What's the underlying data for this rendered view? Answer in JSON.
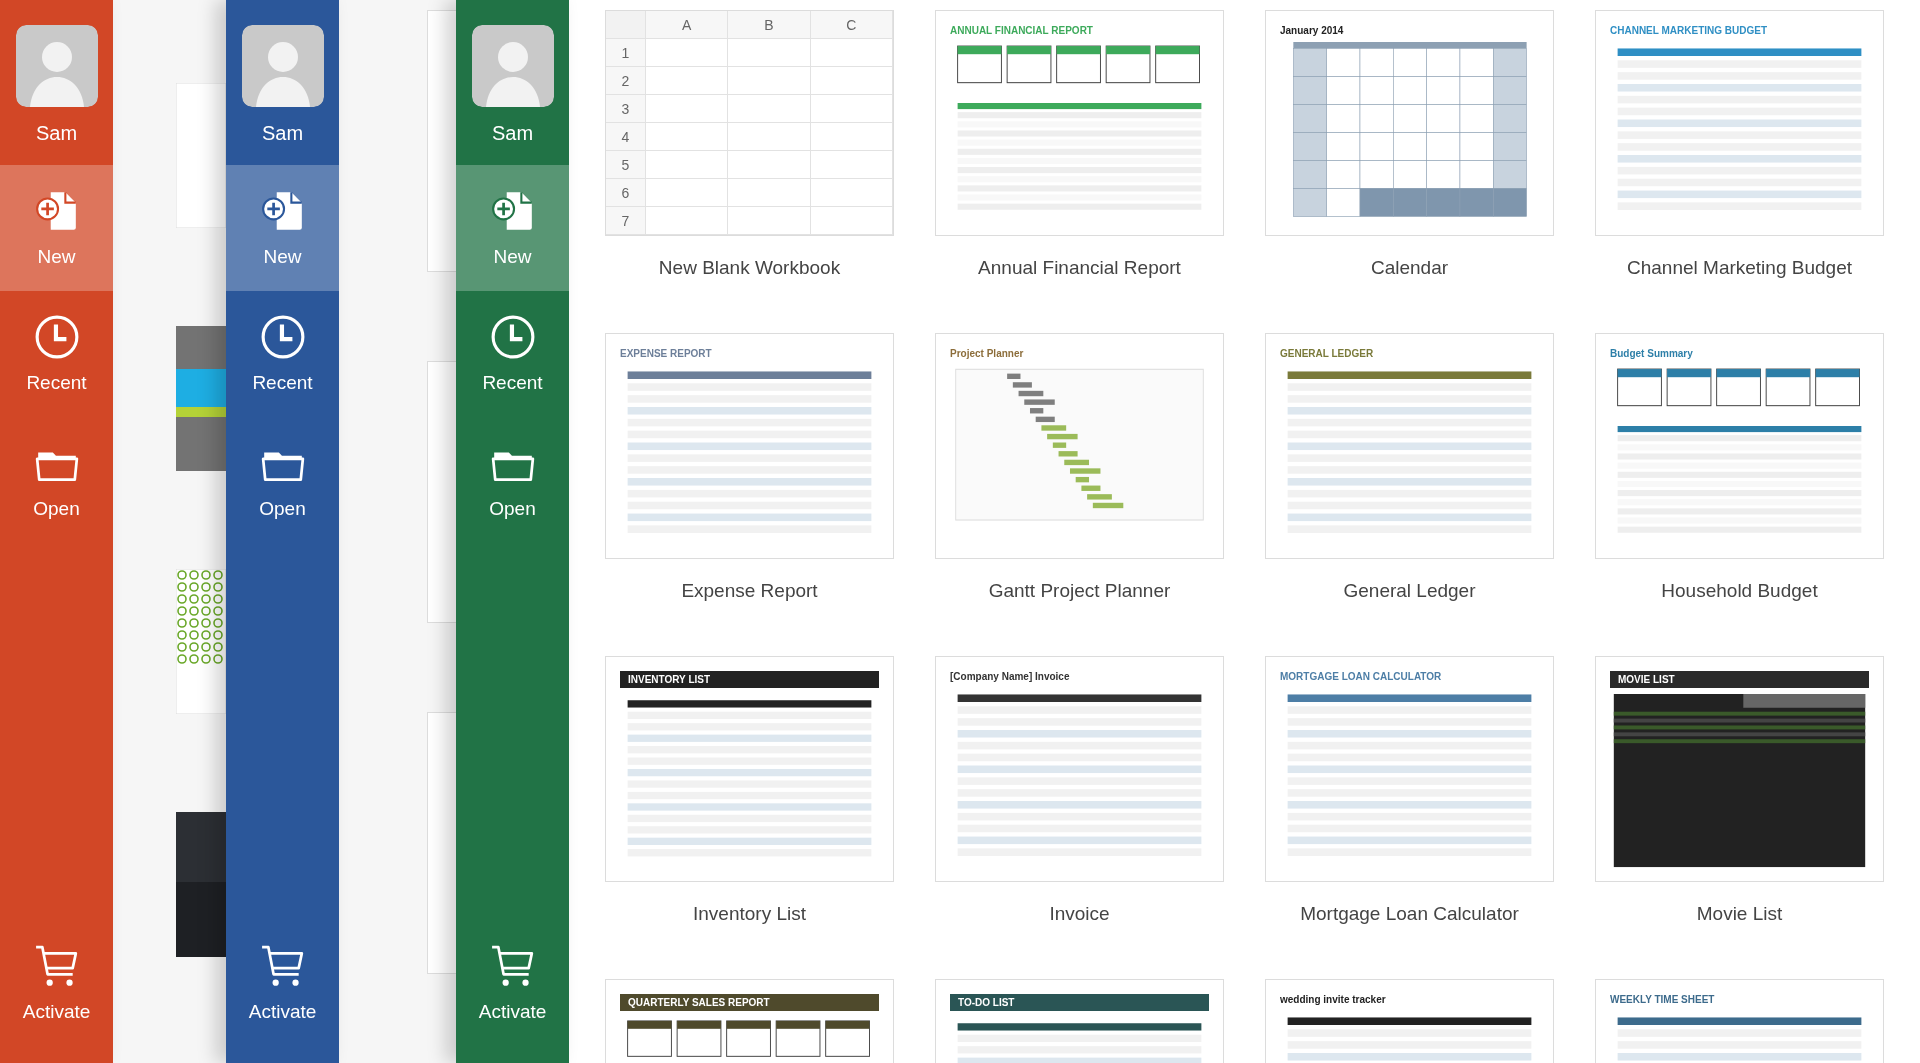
{
  "sidebars": [
    {
      "color": "#d24726",
      "user": "Sam",
      "items": [
        {
          "kind": "new",
          "label": "New",
          "selected": true
        },
        {
          "kind": "recent",
          "label": "Recent",
          "selected": false
        },
        {
          "kind": "open",
          "label": "Open",
          "selected": false
        }
      ],
      "footer": {
        "kind": "cart",
        "label": "Activate"
      }
    },
    {
      "color": "#2b579a",
      "user": "Sam",
      "items": [
        {
          "kind": "new",
          "label": "New",
          "selected": true
        },
        {
          "kind": "recent",
          "label": "Recent",
          "selected": false
        },
        {
          "kind": "open",
          "label": "Open",
          "selected": false
        }
      ],
      "footer": {
        "kind": "cart",
        "label": "Activate"
      }
    },
    {
      "color": "#217346",
      "user": "Sam",
      "items": [
        {
          "kind": "new",
          "label": "New",
          "selected": true
        },
        {
          "kind": "recent",
          "label": "Recent",
          "selected": false
        },
        {
          "kind": "open",
          "label": "Open",
          "selected": false
        }
      ],
      "footer": {
        "kind": "cart",
        "label": "Activate"
      }
    }
  ],
  "slides_behind": [
    {
      "kind": "blank"
    },
    {
      "kind": "stripes"
    },
    {
      "kind": "pattern"
    },
    {
      "kind": "dark"
    }
  ],
  "documents_behind": [
    {
      "kind": "page"
    },
    {
      "kind": "page"
    },
    {
      "kind": "page"
    }
  ],
  "templates": [
    {
      "kind": "blank",
      "name": "New Blank Workbook",
      "columns": [
        "A",
        "B",
        "C"
      ],
      "rows": [
        "1",
        "2",
        "3",
        "4",
        "5",
        "6",
        "7"
      ]
    },
    {
      "kind": "report",
      "name": "Annual Financial Report",
      "heading": "ANNUAL FINANCIAL REPORT",
      "heading_bar": false,
      "color": "#3daa5b"
    },
    {
      "kind": "calendar",
      "name": "Calendar",
      "heading": "January 2014",
      "heading_bar": false,
      "color": "#222222"
    },
    {
      "kind": "table",
      "name": "Channel Marketing Budget",
      "heading": "CHANNEL MARKETING BUDGET",
      "heading_bar": false,
      "color": "#2f8fc4"
    },
    {
      "kind": "table",
      "name": "Expense Report",
      "heading": "EXPENSE REPORT",
      "heading_bar": false,
      "color": "#6d7f99"
    },
    {
      "kind": "gantt",
      "name": "Gantt Project Planner",
      "heading": "Project Planner",
      "heading_bar": false,
      "color": "#8c6d3a"
    },
    {
      "kind": "table",
      "name": "General Ledger",
      "heading": "GENERAL LEDGER",
      "heading_bar": false,
      "color": "#7a7a3a"
    },
    {
      "kind": "report",
      "name": "Household Budget",
      "heading": "Budget Summary",
      "heading_bar": false,
      "color": "#2d7fa8"
    },
    {
      "kind": "table",
      "name": "Inventory List",
      "heading": "INVENTORY LIST",
      "heading_bar": true,
      "color": "#222222"
    },
    {
      "kind": "table",
      "name": "Invoice",
      "heading": "[Company Name] Invoice",
      "heading_bar": false,
      "color": "#333333"
    },
    {
      "kind": "table",
      "name": "Mortgage Loan Calculator",
      "heading": "MORTGAGE LOAN CALCULATOR",
      "heading_bar": false,
      "color": "#4d7ea6"
    },
    {
      "kind": "dark",
      "name": "Movie List",
      "heading": "MOVIE LIST",
      "heading_bar": true,
      "color": "#2a2a2a"
    },
    {
      "kind": "report",
      "heading": "QUARTERLY SALES REPORT",
      "heading_bar": true,
      "color": "#4f4a2c"
    },
    {
      "kind": "table",
      "heading": "TO-DO LIST",
      "heading_bar": true,
      "color": "#2a5555"
    },
    {
      "kind": "table",
      "heading": "wedding invite tracker",
      "heading_bar": false,
      "color": "#222222"
    },
    {
      "kind": "table",
      "heading": "WEEKLY TIME SHEET",
      "heading_bar": false,
      "color": "#3d6b8c"
    }
  ]
}
